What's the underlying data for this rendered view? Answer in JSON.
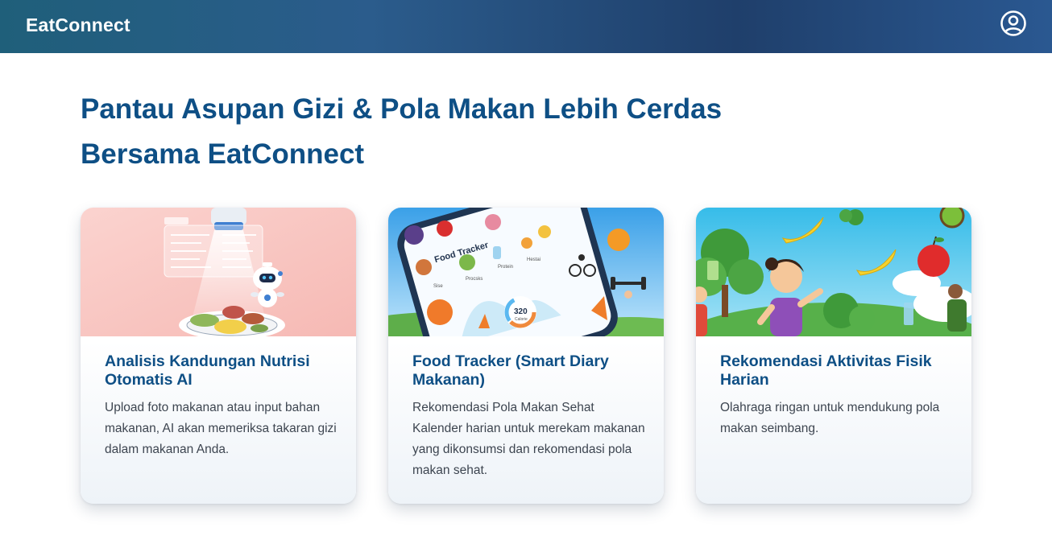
{
  "header": {
    "brand": "EatConnect",
    "profile_icon": "user-circle-icon",
    "colors": {
      "start": "#1f5f7a",
      "mid": "#2b5c8c",
      "end": "#1f3f6b"
    }
  },
  "hero": {
    "title_line1": "Pantau Asupan Gizi & Pola Makan Lebih Cerdas",
    "title_line2": "Bersama EatConnect"
  },
  "cards": [
    {
      "image": "ai-nutrition-robot-illustration",
      "title": "Analisis Kandungan Nutrisi Otomatis AI",
      "description": "Upload foto makanan atau input bahan makanan, AI akan memeriksa takaran gizi dalam makanan Anda."
    },
    {
      "image": "food-tracker-phone-illustration",
      "image_texts": {
        "app_title": "Food Tracker",
        "calories": "320",
        "calories_unit": "Calorie",
        "cat1": "Sise",
        "cat2": "Procsks",
        "cat3": "Protein",
        "cat4": "Hestai"
      },
      "title": "Food Tracker (Smart Diary Makanan)",
      "description": "Rekomendasi Pola Makan Sehat Kalender harian untuk merekam makanan yang dikonsumsi dan rekomendasi pola makan sehat."
    },
    {
      "image": "physical-activity-illustration",
      "title": "Rekomendasi Aktivitas Fisik Harian",
      "description": "Olahraga ringan untuk mendukung pola makan seimbang."
    }
  ],
  "colors": {
    "title": "#0e4f85",
    "text": "#3d4550",
    "card_bg": "#ffffff"
  }
}
